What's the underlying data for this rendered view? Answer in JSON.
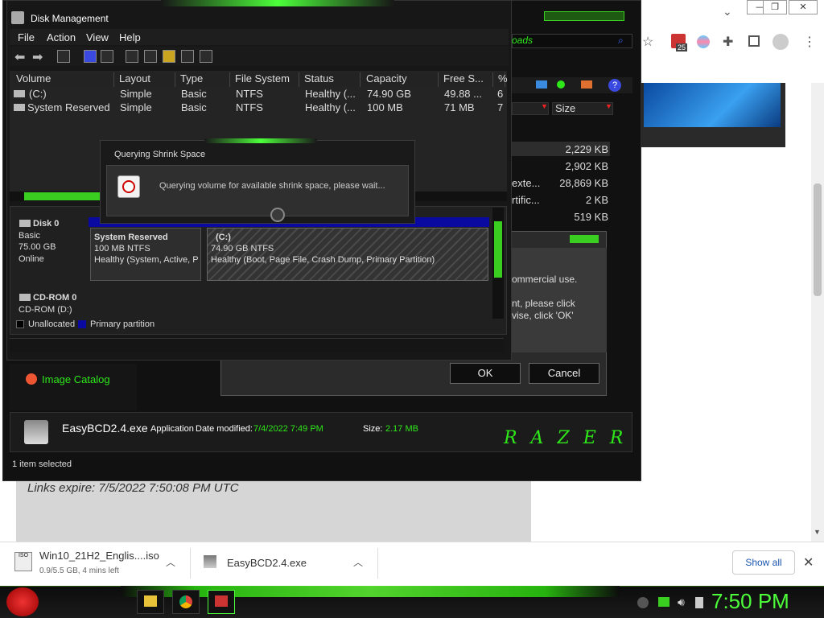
{
  "browser": {
    "links_expire": "Links expire: 7/5/2022 7:50:08 PM UTC",
    "bookmark_badge": "25",
    "search_fragment": "oads"
  },
  "explorer": {
    "col_size": "Size",
    "sizes": [
      "2,229 KB",
      "2,902 KB",
      "28,869 KB",
      "2 KB",
      "519 KB"
    ],
    "name_fragments": [
      "exte...",
      "rtific..."
    ],
    "sidebar_link": "Image Catalog",
    "dialog_text_1": "ommercial use.",
    "dialog_text_2": "nt, please click",
    "dialog_text_3": "vise, click 'OK'",
    "ok_label": "OK",
    "cancel_label": "Cancel",
    "file_name": "EasyBCD2.4.exe",
    "file_type": "Application",
    "date_label": "Date modified:",
    "date_value": "7/4/2022 7:49 PM",
    "size_label": "Size:",
    "size_value": "2.17 MB",
    "status": "1 item selected",
    "brand": "RAZER"
  },
  "disk_management": {
    "title": "Disk Management",
    "menu": [
      "File",
      "Action",
      "View",
      "Help"
    ],
    "columns": [
      "Volume",
      "Layout",
      "Type",
      "File System",
      "Status",
      "Capacity",
      "Free S...",
      "%"
    ],
    "rows": [
      [
        "(C:)",
        "Simple",
        "Basic",
        "NTFS",
        "Healthy (...",
        "74.90 GB",
        "49.88 ...",
        "6"
      ],
      [
        "System Reserved",
        "Simple",
        "Basic",
        "NTFS",
        "Healthy (...",
        "100 MB",
        "71 MB",
        "7"
      ]
    ],
    "disk0": {
      "name": "Disk 0",
      "type": "Basic",
      "size": "75.00 GB",
      "status": "Online"
    },
    "cdrom": {
      "name": "CD-ROM 0",
      "drive": "CD-ROM (D:)"
    },
    "part_sys": {
      "name": "System Reserved",
      "size": "100 MB NTFS",
      "health": "Healthy (System, Active, P"
    },
    "part_c": {
      "name": "(C:)",
      "size": "74.90 GB NTFS",
      "health": "Healthy (Boot, Page File, Crash Dump, Primary Partition)"
    },
    "legend": [
      "Unallocated",
      "Primary partition"
    ]
  },
  "query_dialog": {
    "title": "Querying Shrink Space",
    "message": "Querying volume for available shrink space, please wait..."
  },
  "downloads": {
    "item1_name": "Win10_21H2_Englis....iso",
    "item1_sub": "0.9/5.5 GB, 4 mins left",
    "item2_name": "EasyBCD2.4.exe",
    "show_all": "Show all"
  },
  "taskbar": {
    "clock": "7:50 PM"
  },
  "colors": {
    "accent": "#4cff3a",
    "partition_blue": "#0a0aa0"
  }
}
